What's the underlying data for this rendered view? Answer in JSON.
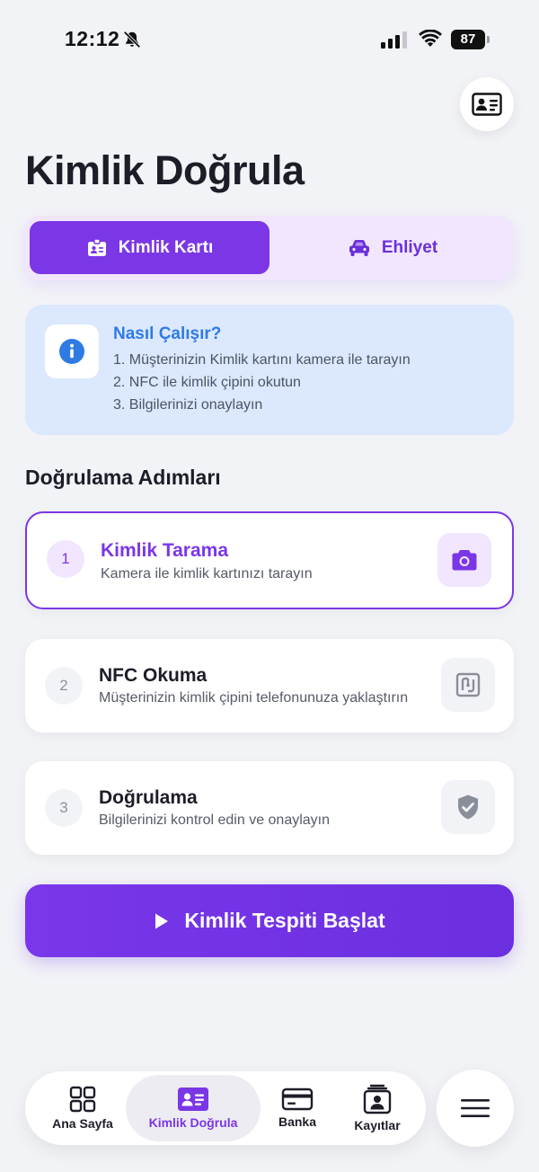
{
  "status_bar": {
    "time": "12:12",
    "battery": "87"
  },
  "header": {
    "title": "Kimlik Doğrula"
  },
  "tabs": [
    {
      "label": "Kimlik Kartı",
      "icon": "id-badge-icon",
      "active": true
    },
    {
      "label": "Ehliyet",
      "icon": "car-icon",
      "active": false
    }
  ],
  "info": {
    "title": "Nasıl Çalışır?",
    "lines": [
      "1. Müşterinizin Kimlik kartını kamera ile tarayın",
      "2. NFC ile kimlik çipini okutun",
      "3. Bilgilerinizi onaylayın"
    ]
  },
  "steps_section": {
    "title": "Doğrulama Adımları"
  },
  "steps": [
    {
      "number": "1",
      "title": "Kimlik Tarama",
      "description": "Kamera ile kimlik kartınızı tarayın",
      "icon": "camera-icon",
      "active": true
    },
    {
      "number": "2",
      "title": "NFC Okuma",
      "description": "Müşterinizin kimlik çipini telefonunuza yaklaştırın",
      "icon": "nfc-icon",
      "active": false
    },
    {
      "number": "3",
      "title": "Doğrulama",
      "description": "Bilgilerinizi kontrol edin ve onaylayın",
      "icon": "shield-check-icon",
      "active": false
    }
  ],
  "start_button": {
    "label": "Kimlik Tespiti Başlat",
    "icon": "play-icon"
  },
  "bottom_nav": {
    "items": [
      {
        "label": "Ana Sayfa",
        "icon": "grid-icon",
        "active": false
      },
      {
        "label": "Kimlik Doğrula",
        "icon": "id-card-icon",
        "active": true
      },
      {
        "label": "Banka",
        "icon": "credit-card-icon",
        "active": false
      },
      {
        "label": "Kayıtlar",
        "icon": "records-icon",
        "active": false
      }
    ],
    "menu_icon": "menu-icon"
  },
  "colors": {
    "accent": "#7b36e6",
    "background": "#f2f3f7",
    "info_bg": "#dbe8fd",
    "info_title": "#2f7be4",
    "tab_bg": "#f1e6fd"
  }
}
